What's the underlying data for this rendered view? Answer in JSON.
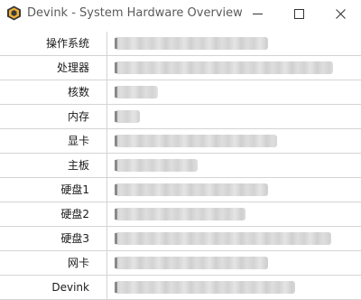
{
  "window": {
    "title": "Devink - System Hardware Overview",
    "icon": "devink-app-icon",
    "controls": [
      "minimize-icon",
      "maximize-icon",
      "close-icon"
    ]
  },
  "specs": [
    {
      "label": "操作系统",
      "value": ""
    },
    {
      "label": "处理器",
      "value": ""
    },
    {
      "label": "核数",
      "value": ""
    },
    {
      "label": "内存",
      "value": ""
    },
    {
      "label": "显卡",
      "value": ""
    },
    {
      "label": "主板",
      "value": ""
    },
    {
      "label": "硬盘1",
      "value": ""
    },
    {
      "label": "硬盘2",
      "value": ""
    },
    {
      "label": "硬盘3",
      "value": ""
    },
    {
      "label": "网卡",
      "value": ""
    },
    {
      "label": "Devink",
      "value": ""
    }
  ],
  "colors": {
    "titlebar_bg": "#ffffff",
    "title_text": "#5a5a5a",
    "gridline": "#d4d4d4",
    "redacted": "#cccccc"
  }
}
